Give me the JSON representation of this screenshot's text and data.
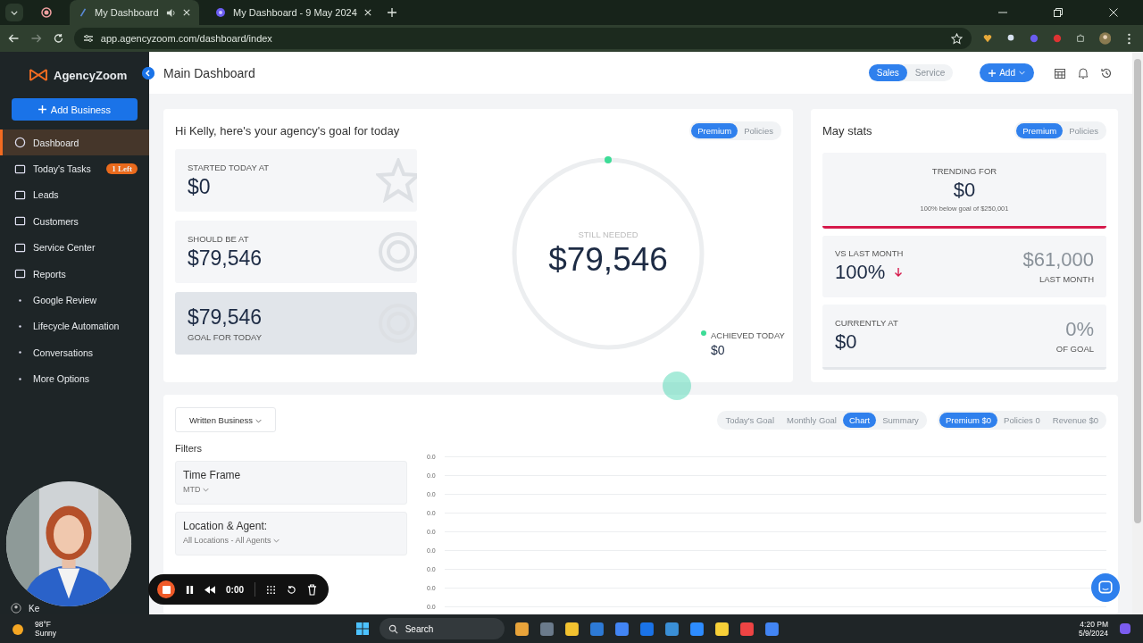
{
  "browser": {
    "tabs": [
      {
        "title": "My Dashboard",
        "selected": true,
        "audio": true
      },
      {
        "title": "My Dashboard - 9 May 2024",
        "selected": false,
        "audio": false
      }
    ],
    "url": "app.agencyzoom.com/dashboard/index"
  },
  "sidebar": {
    "logo": "AgencyZoom",
    "add_button": "Add Business",
    "items": [
      {
        "label": "Dashboard",
        "selected": true
      },
      {
        "label": "Today's Tasks",
        "selected": false,
        "badge": "1 Left"
      },
      {
        "label": "Leads",
        "selected": false
      },
      {
        "label": "Customers",
        "selected": false
      },
      {
        "label": "Service Center",
        "selected": false
      },
      {
        "label": "Reports",
        "selected": false
      },
      {
        "label": "Google Review",
        "selected": false
      },
      {
        "label": "Lifecycle Automation",
        "selected": false
      },
      {
        "label": "Conversations",
        "selected": false
      },
      {
        "label": "More Options",
        "selected": false
      }
    ],
    "user": "Ke"
  },
  "header": {
    "title": "Main Dashboard",
    "segments": [
      {
        "label": "Sales",
        "selected": true
      },
      {
        "label": "Service",
        "selected": false
      }
    ],
    "add_button": "Add"
  },
  "goal_card": {
    "heading": "Hi Kelly, here's your agency's goal for today",
    "toggle": [
      {
        "label": "Premium",
        "selected": true
      },
      {
        "label": "Policies",
        "selected": false
      }
    ],
    "tiles": [
      {
        "label": "STARTED TODAY AT",
        "value": "$0",
        "highlighted": false
      },
      {
        "label": "SHOULD BE AT",
        "value": "$79,546",
        "highlighted": false
      },
      {
        "label": "GOAL FOR TODAY",
        "value": "$79,546",
        "highlighted": true
      }
    ],
    "ring": {
      "label": "STILL NEEDED",
      "value": "$79,546"
    },
    "achieved": {
      "label": "ACHIEVED TODAY",
      "value": "$0"
    }
  },
  "stats_card": {
    "title": "May stats",
    "toggle": [
      {
        "label": "Premium",
        "selected": true
      },
      {
        "label": "Policies",
        "selected": false
      }
    ],
    "trending": {
      "label": "TRENDING FOR",
      "value": "$0",
      "note": "100% below goal of $250,001"
    },
    "vs_last_month": {
      "label": "VS LAST MONTH",
      "value": "100%",
      "falling": true,
      "compare_value": "$61,000",
      "compare_label": "LAST MONTH"
    },
    "currently": {
      "label": "CURRENTLY AT",
      "value": "$0",
      "percent": "0%",
      "percent_label": "OF GOAL"
    }
  },
  "bottom_card": {
    "dropdown": "Written Business",
    "filters_label": "Filters",
    "filters": [
      {
        "title": "Time Frame",
        "value": "MTD"
      },
      {
        "title": "Location & Agent:",
        "value": "All Locations - All Agents"
      }
    ],
    "view_tabs": [
      {
        "label": "Today's Goal",
        "selected": false
      },
      {
        "label": "Monthly Goal",
        "selected": false
      },
      {
        "label": "Chart",
        "selected": true
      },
      {
        "label": "Summary",
        "selected": false
      }
    ],
    "metric_tabs": [
      {
        "label": "Premium $0",
        "selected": true
      },
      {
        "label": "Policies 0",
        "selected": false
      },
      {
        "label": "Revenue $0",
        "selected": false
      }
    ],
    "chart_axis_labels": [
      "0.0",
      "0.0",
      "0.0",
      "0.0",
      "0.0",
      "0.0",
      "0.0",
      "0.0",
      "0.0"
    ]
  },
  "recorder": {
    "time": "0:00"
  },
  "taskbar": {
    "temperature": "98°F",
    "weather": "Sunny",
    "search": "Search",
    "time": "4:20 PM",
    "date": "5/9/2024"
  }
}
